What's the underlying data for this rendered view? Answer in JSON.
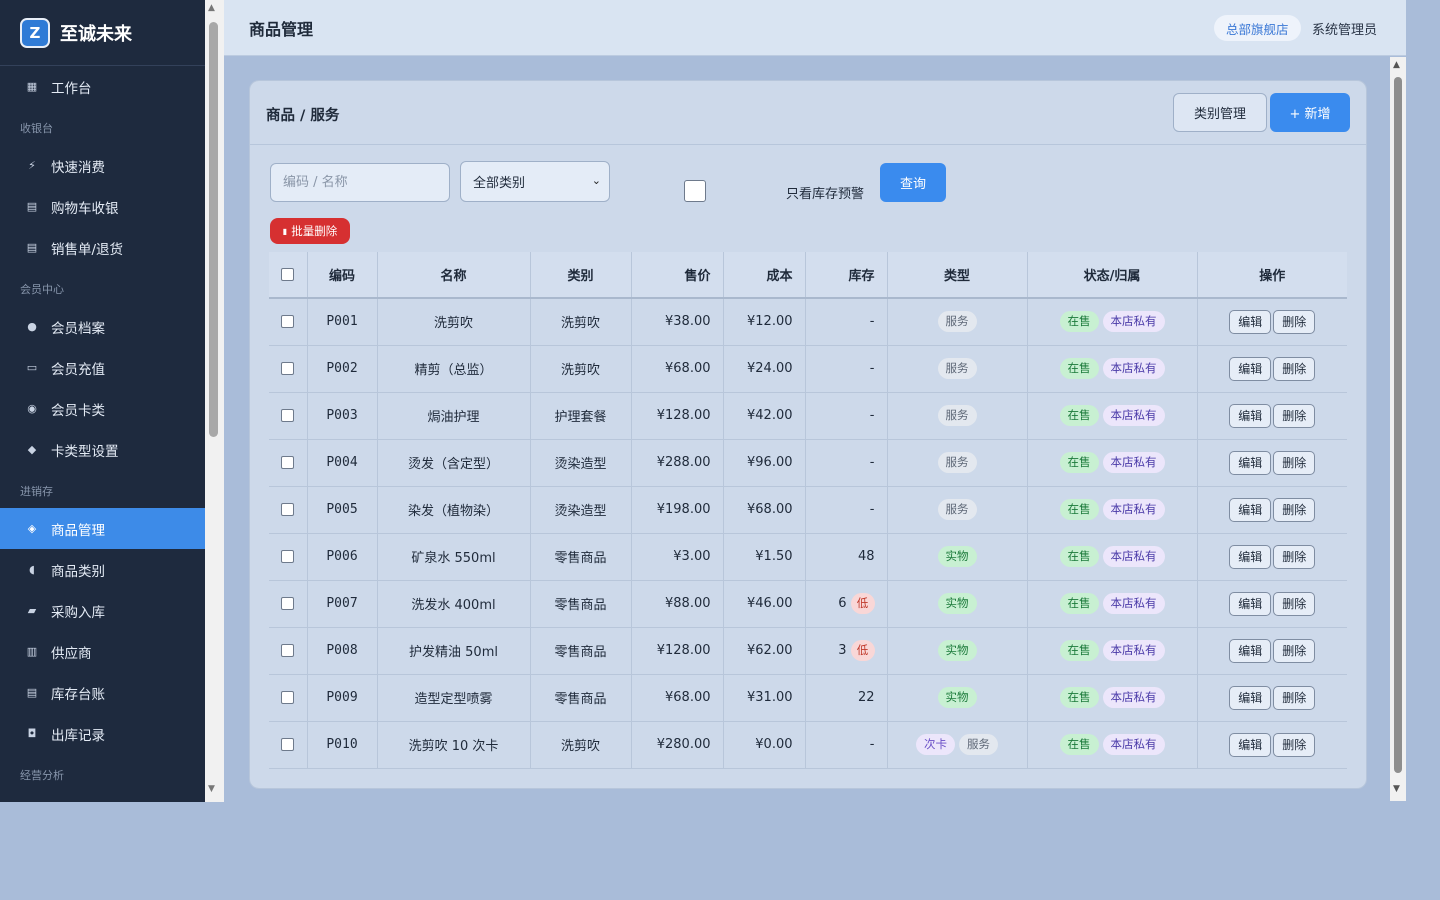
{
  "brand": {
    "logo_letter": "Z",
    "name": "至诚未来"
  },
  "sidebar": {
    "top": {
      "label": "工作台",
      "icon": "grid-icon"
    },
    "groups": [
      {
        "title": "收银台",
        "items": [
          {
            "label": "快速消费",
            "icon": "bolt-icon"
          },
          {
            "label": "购物车收银",
            "icon": "cart-icon"
          },
          {
            "label": "销售单/退货",
            "icon": "receipt-icon"
          }
        ]
      },
      {
        "title": "会员中心",
        "items": [
          {
            "label": "会员档案",
            "icon": "user-icon"
          },
          {
            "label": "会员充值",
            "icon": "credit-card-icon"
          },
          {
            "label": "会员卡类",
            "icon": "medal-icon"
          },
          {
            "label": "卡类型设置",
            "icon": "card-settings-icon"
          }
        ]
      },
      {
        "title": "进销存",
        "items": [
          {
            "label": "商品管理",
            "icon": "box-icon",
            "active": true
          },
          {
            "label": "商品类别",
            "icon": "tag-icon"
          },
          {
            "label": "采购入库",
            "icon": "truck-icon"
          },
          {
            "label": "供应商",
            "icon": "factory-icon"
          },
          {
            "label": "库存台账",
            "icon": "ledger-icon"
          },
          {
            "label": "出库记录",
            "icon": "outbox-icon"
          }
        ]
      },
      {
        "title": "经营分析",
        "items": []
      }
    ]
  },
  "header": {
    "title": "商品管理",
    "store": "总部旗舰店",
    "user": "系统管理员"
  },
  "card": {
    "title": "商品 / 服务",
    "category_button": "类别管理",
    "new_button": "+ 新增"
  },
  "filters": {
    "search_placeholder": "编码 / 名称",
    "category_selected": "全部类别",
    "warning_only_label": "只看库存预警",
    "query_button": "查询",
    "bulk_delete_button": "批量删除"
  },
  "table": {
    "columns": [
      "编码",
      "名称",
      "类别",
      "售价",
      "成本",
      "库存",
      "类型",
      "状态/归属",
      "操作"
    ],
    "actions": {
      "edit": "编辑",
      "delete": "删除"
    },
    "rows": [
      {
        "code": "P001",
        "name": "洗剪吹",
        "category": "洗剪吹",
        "price": "¥38.00",
        "cost": "¥12.00",
        "stock": "-",
        "low": "",
        "types": [
          "服务"
        ],
        "status": "在售",
        "owner": "本店私有"
      },
      {
        "code": "P002",
        "name": "精剪（总监）",
        "category": "洗剪吹",
        "price": "¥68.00",
        "cost": "¥24.00",
        "stock": "-",
        "low": "",
        "types": [
          "服务"
        ],
        "status": "在售",
        "owner": "本店私有"
      },
      {
        "code": "P003",
        "name": "焗油护理",
        "category": "护理套餐",
        "price": "¥128.00",
        "cost": "¥42.00",
        "stock": "-",
        "low": "",
        "types": [
          "服务"
        ],
        "status": "在售",
        "owner": "本店私有"
      },
      {
        "code": "P004",
        "name": "烫发（含定型）",
        "category": "烫染造型",
        "price": "¥288.00",
        "cost": "¥96.00",
        "stock": "-",
        "low": "",
        "types": [
          "服务"
        ],
        "status": "在售",
        "owner": "本店私有"
      },
      {
        "code": "P005",
        "name": "染发（植物染）",
        "category": "烫染造型",
        "price": "¥198.00",
        "cost": "¥68.00",
        "stock": "-",
        "low": "",
        "types": [
          "服务"
        ],
        "status": "在售",
        "owner": "本店私有"
      },
      {
        "code": "P006",
        "name": "矿泉水 550ml",
        "category": "零售商品",
        "price": "¥3.00",
        "cost": "¥1.50",
        "stock": "48",
        "low": "",
        "types": [
          "实物"
        ],
        "status": "在售",
        "owner": "本店私有"
      },
      {
        "code": "P007",
        "name": "洗发水 400ml",
        "category": "零售商品",
        "price": "¥88.00",
        "cost": "¥46.00",
        "stock": "6",
        "low": "低",
        "types": [
          "实物"
        ],
        "status": "在售",
        "owner": "本店私有"
      },
      {
        "code": "P008",
        "name": "护发精油 50ml",
        "category": "零售商品",
        "price": "¥128.00",
        "cost": "¥62.00",
        "stock": "3",
        "low": "低",
        "types": [
          "实物"
        ],
        "status": "在售",
        "owner": "本店私有"
      },
      {
        "code": "P009",
        "name": "造型定型喷雾",
        "category": "零售商品",
        "price": "¥68.00",
        "cost": "¥31.00",
        "stock": "22",
        "low": "",
        "types": [
          "实物"
        ],
        "status": "在售",
        "owner": "本店私有"
      },
      {
        "code": "P010",
        "name": "洗剪吹 10 次卡",
        "category": "洗剪吹",
        "price": "¥280.00",
        "cost": "¥0.00",
        "stock": "-",
        "low": "",
        "types": [
          "次卡",
          "服务"
        ],
        "status": "在售",
        "owner": "本店私有"
      }
    ]
  },
  "colors": {
    "sidebar_bg": "#1e2a3e",
    "accent": "#3a8bee",
    "danger": "#d63031",
    "page_bg": "#a9bcd9"
  }
}
